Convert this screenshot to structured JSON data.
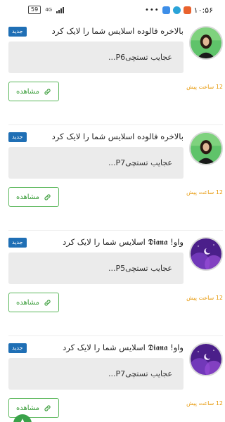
{
  "status_bar": {
    "battery": "59",
    "network_type": "4G",
    "clock": "۱۰:۵۶",
    "dots": "•••"
  },
  "notifications": [
    {
      "badge": "جدید",
      "title": "بالاخره فالوده اسلایس شما را لایک کرد",
      "preview": "عجایب تستچیP6...",
      "time": "12 ساعت پیش",
      "button_label": "مشاهده",
      "avatar": "green-woman"
    },
    {
      "badge": "جدید",
      "title": "بالاخره فالوده اسلایس شما را لایک کرد",
      "preview": "عجایب تستچیP7...",
      "time": "12 ساعت پیش",
      "button_label": "مشاهده",
      "avatar": "green-woman"
    },
    {
      "badge": "جدید",
      "title": "واو! 𝕯𝖎𝖆𝖓𝖆 اسلایس شما را لایک کرد",
      "preview": "عجایب تستچیP5...",
      "time": "12 ساعت پیش",
      "button_label": "مشاهده",
      "avatar": "purple-moon"
    },
    {
      "badge": "جدید",
      "title": "واو! 𝕯𝖎𝖆𝖓𝖆 اسلایس شما را لایک کرد",
      "preview": "عجایب تستچیP7...",
      "time": "12 ساعت پیش",
      "button_label": "مشاهده",
      "avatar": "purple-moon"
    }
  ],
  "colors": {
    "badge": "#1f6fb5",
    "time": "#e69500",
    "button_border": "#5cb85c",
    "preview_bg": "#ebebeb"
  },
  "fab_icon": "arrow-up-icon"
}
